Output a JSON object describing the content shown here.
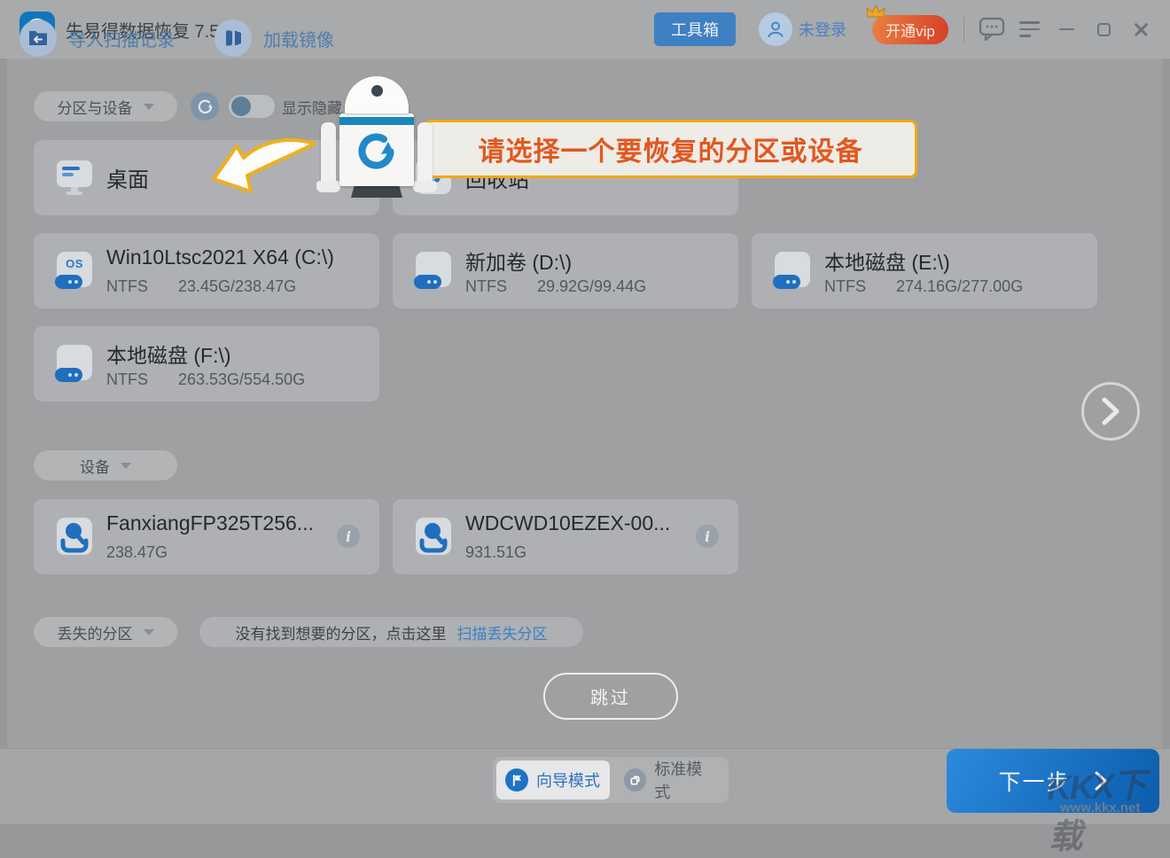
{
  "titlebar": {
    "app_title": "失易得数据恢复 7.52",
    "toolbox_label": "工具箱",
    "login_label": "未登录",
    "vip_label": "开通vip"
  },
  "guide": {
    "tooltip_text": "请选择一个要恢复的分区或设备"
  },
  "sections": {
    "partitions_label": "分区与设备",
    "show_hidden_label": "显示隐藏",
    "devices_label": "设备",
    "lost_label": "丢失的分区",
    "lost_hint": "没有找到想要的分区，点击这里",
    "scan_lost_link": "扫描丢失分区"
  },
  "special_items": {
    "desktop_label": "桌面",
    "recycle_label": "回收站"
  },
  "partitions": [
    {
      "name": "Win10Ltsc2021 X64 (C:\\)",
      "fs": "NTFS",
      "size": "23.45G/238.47G",
      "badge": "OS"
    },
    {
      "name": "新加卷 (D:\\)",
      "fs": "NTFS",
      "size": "29.92G/99.44G"
    },
    {
      "name": "本地磁盘 (E:\\)",
      "fs": "NTFS",
      "size": "274.16G/277.00G"
    },
    {
      "name": "本地磁盘 (F:\\)",
      "fs": "NTFS",
      "size": "263.53G/554.50G"
    }
  ],
  "devices": [
    {
      "name": "FanxiangFP325T256...",
      "size": "238.47G"
    },
    {
      "name": "WDCWD10EZEX-00...",
      "size": "931.51G"
    }
  ],
  "actions": {
    "skip_label": "跳过"
  },
  "footer": {
    "import_label": "导入扫描记录",
    "load_image_label": "加载镜像",
    "wizard_mode_label": "向导模式",
    "standard_mode_label": "标准模式",
    "next_label": "下一步"
  },
  "watermark": {
    "logo_text": "KKX下载",
    "site_url": "www.kkx.net"
  },
  "colors": {
    "accent_blue": "#1b7fd8",
    "toolbox_blue": "#3e80c2",
    "vip_gradient_start": "#ea8040",
    "vip_gradient_end": "#d5402a",
    "tooltip_border": "#f0aa12",
    "tooltip_text": "#e1581f",
    "link_blue": "#3c80c9"
  }
}
